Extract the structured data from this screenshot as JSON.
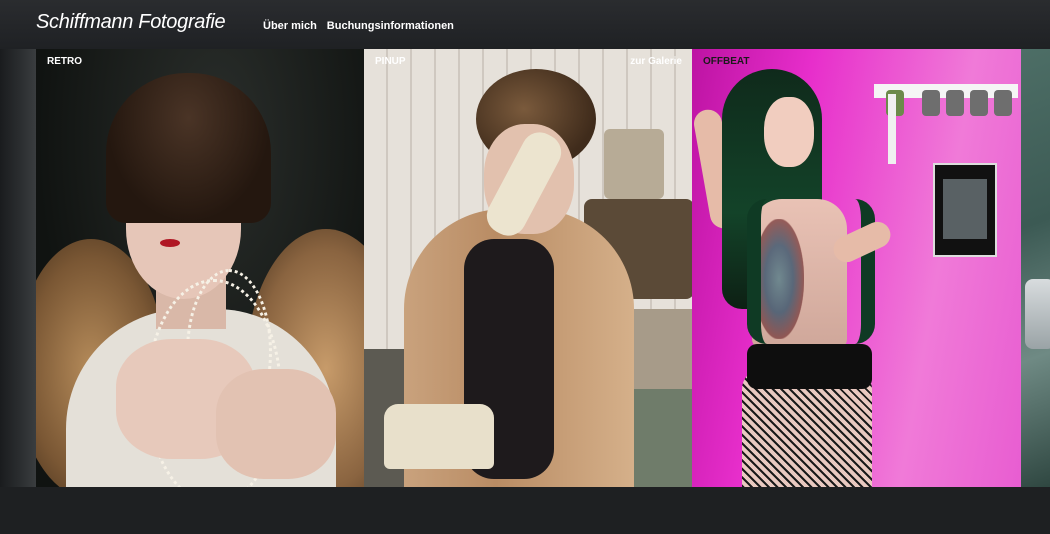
{
  "header": {
    "site_title": "Schiffmann Fotografie",
    "nav": [
      {
        "label": "Über mich"
      },
      {
        "label": "Buchungsinformationen"
      }
    ]
  },
  "gallery": {
    "panels": [
      {
        "label": "RETRO"
      },
      {
        "label": "PINUP",
        "link_label": "zur Galerie"
      },
      {
        "label": "OFFBEAT"
      }
    ]
  }
}
